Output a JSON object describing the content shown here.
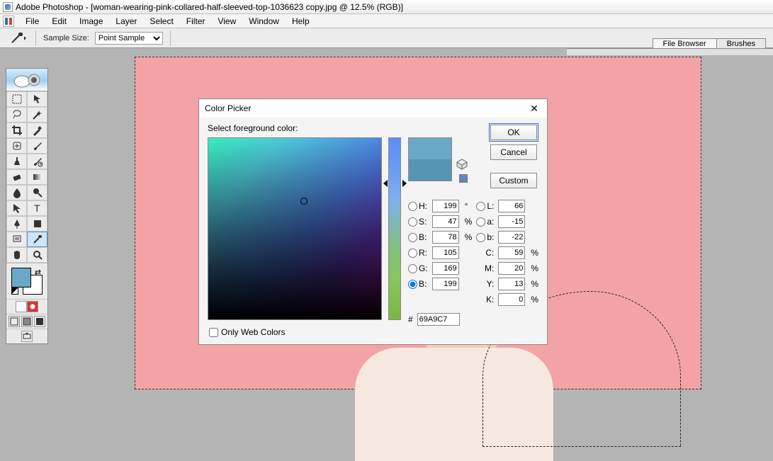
{
  "app": {
    "name": "Adobe Photoshop",
    "doc": "woman-wearing-pink-collared-half-sleeved-top-1036623 copy.jpg",
    "zoom": "12.5%",
    "mode": "RGB"
  },
  "title_full": "Adobe Photoshop - [woman-wearing-pink-collared-half-sleeved-top-1036623 copy.jpg @ 12.5% (RGB)]",
  "menus": [
    "File",
    "Edit",
    "Image",
    "Layer",
    "Select",
    "Filter",
    "View",
    "Window",
    "Help"
  ],
  "options": {
    "sample_label": "Sample Size:",
    "sample_value": "Point Sample"
  },
  "tabs": [
    "File Browser",
    "Brushes"
  ],
  "toolbox": {
    "fg_color": "#69a9c7",
    "bg_color": "#ffffff",
    "active_tool": "eyedropper"
  },
  "color_picker": {
    "title": "Color Picker",
    "subtitle": "Select foreground color:",
    "buttons": {
      "ok": "OK",
      "cancel": "Cancel",
      "custom": "Custom"
    },
    "hsb": {
      "H_label": "H:",
      "H": "199",
      "H_suffix": "°",
      "S_label": "S:",
      "S": "47",
      "S_suffix": "%",
      "B_label": "B:",
      "B": "78",
      "B_suffix": "%"
    },
    "lab": {
      "L_label": "L:",
      "L": "66",
      "a_label": "a:",
      "a": "-15",
      "b_label": "b:",
      "b": "-22"
    },
    "rgb": {
      "R_label": "R:",
      "R": "105",
      "G_label": "G:",
      "G": "169",
      "B_label": "B:",
      "B": "199"
    },
    "cmyk": {
      "C_label": "C:",
      "C": "59",
      "M_label": "M:",
      "M": "20",
      "Y_label": "Y:",
      "Y": "13",
      "K_label": "K:",
      "K": "0",
      "suffix": "%"
    },
    "hex_label": "#",
    "hex": "69A9C7",
    "only_web": "Only Web Colors",
    "selected_radio": "rgb_b"
  }
}
